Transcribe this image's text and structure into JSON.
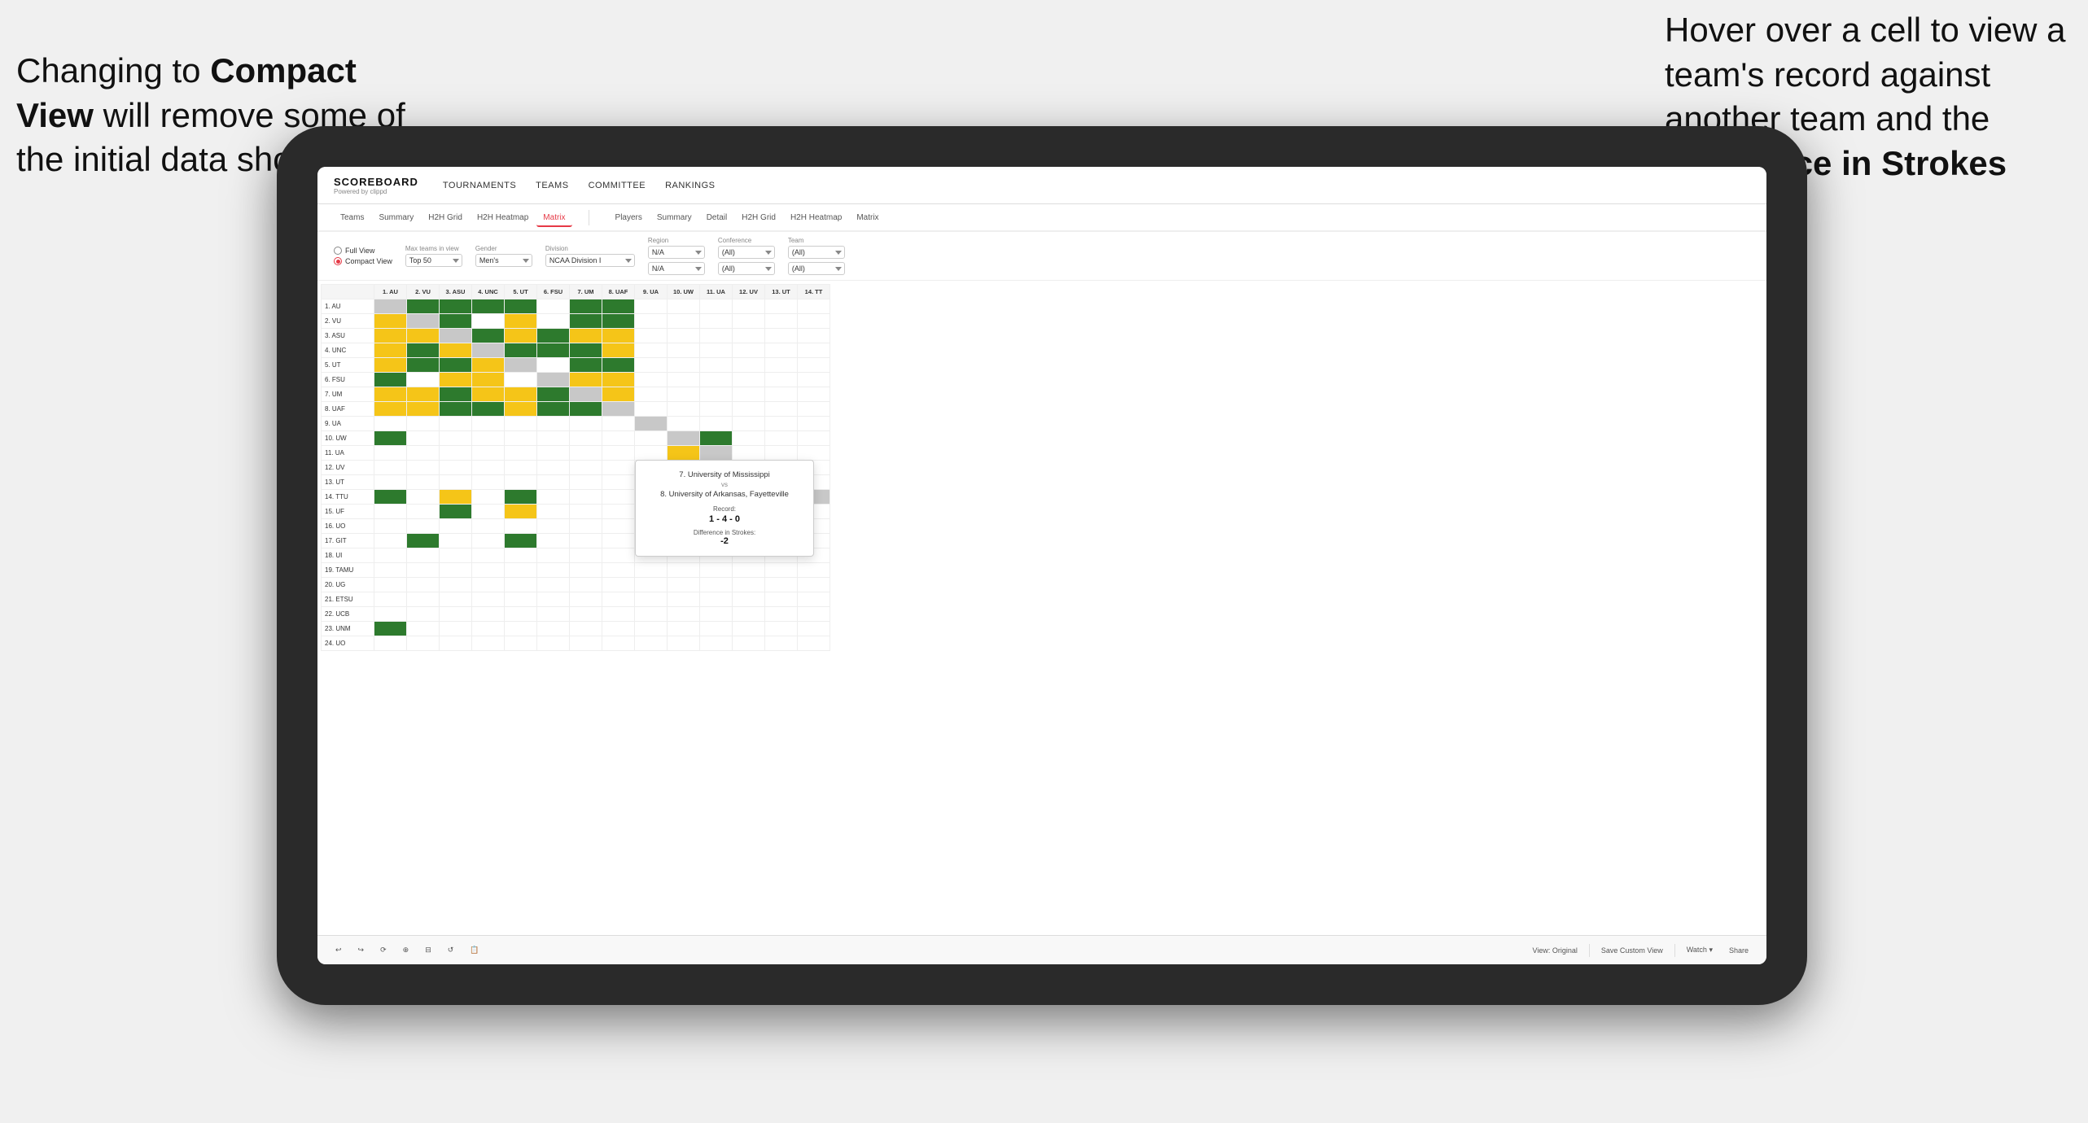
{
  "annotations": {
    "left_text": "Changing to Compact View will remove some of the initial data shown",
    "left_bold": "Compact View",
    "right_text": "Hover over a cell to view a team's record against another team and the Difference in Strokes",
    "right_bold": "Difference in Strokes"
  },
  "nav": {
    "logo": "SCOREBOARD",
    "logo_sub": "Powered by clippd",
    "links": [
      "TOURNAMENTS",
      "TEAMS",
      "COMMITTEE",
      "RANKINGS"
    ]
  },
  "sub_nav_left": {
    "tabs": [
      "Teams",
      "Summary",
      "H2H Grid",
      "H2H Heatmap",
      "Matrix"
    ]
  },
  "sub_nav_right": {
    "tabs": [
      "Players",
      "Summary",
      "Detail",
      "H2H Grid",
      "H2H Heatmap",
      "Matrix"
    ]
  },
  "filters": {
    "view_options": [
      "Full View",
      "Compact View"
    ],
    "selected_view": "Compact View",
    "max_teams_label": "Max teams in view",
    "max_teams_value": "Top 50",
    "gender_label": "Gender",
    "gender_value": "Men's",
    "division_label": "Division",
    "division_value": "NCAA Division I",
    "region_label": "Region",
    "region_values": [
      "N/A",
      "N/A"
    ],
    "conference_label": "Conference",
    "conference_values": [
      "(All)",
      "(All)"
    ],
    "team_label": "Team",
    "team_values": [
      "(All)",
      "(All)"
    ]
  },
  "matrix": {
    "col_headers": [
      "1. AU",
      "2. VU",
      "3. ASU",
      "4. UNC",
      "5. UT",
      "6. FSU",
      "7. UM",
      "8. UAF",
      "9. UA",
      "10. UW",
      "11. UA",
      "12. UV",
      "13. UT",
      "14. TT"
    ],
    "rows": [
      {
        "label": "1. AU",
        "cells": [
          "gray",
          "green",
          "green",
          "green",
          "green",
          "white",
          "green",
          "green",
          "white",
          "white",
          "white",
          "white",
          "white",
          "white"
        ]
      },
      {
        "label": "2. VU",
        "cells": [
          "yellow",
          "gray",
          "green",
          "white",
          "yellow",
          "white",
          "green",
          "green",
          "white",
          "white",
          "white",
          "white",
          "white",
          "white"
        ]
      },
      {
        "label": "3. ASU",
        "cells": [
          "yellow",
          "yellow",
          "gray",
          "green",
          "yellow",
          "green",
          "yellow",
          "yellow",
          "white",
          "white",
          "white",
          "white",
          "white",
          "white"
        ]
      },
      {
        "label": "4. UNC",
        "cells": [
          "yellow",
          "green",
          "yellow",
          "gray",
          "green",
          "green",
          "green",
          "yellow",
          "white",
          "white",
          "white",
          "white",
          "white",
          "white"
        ]
      },
      {
        "label": "5. UT",
        "cells": [
          "yellow",
          "green",
          "green",
          "yellow",
          "gray",
          "white",
          "green",
          "green",
          "white",
          "white",
          "white",
          "white",
          "white",
          "white"
        ]
      },
      {
        "label": "6. FSU",
        "cells": [
          "green",
          "white",
          "yellow",
          "yellow",
          "white",
          "gray",
          "yellow",
          "yellow",
          "white",
          "white",
          "white",
          "white",
          "white",
          "white"
        ]
      },
      {
        "label": "7. UM",
        "cells": [
          "yellow",
          "yellow",
          "green",
          "yellow",
          "yellow",
          "green",
          "gray",
          "yellow",
          "white",
          "white",
          "white",
          "white",
          "white",
          "white"
        ]
      },
      {
        "label": "8. UAF",
        "cells": [
          "yellow",
          "yellow",
          "green",
          "green",
          "yellow",
          "green",
          "green",
          "gray",
          "white",
          "white",
          "white",
          "white",
          "white",
          "white"
        ]
      },
      {
        "label": "9. UA",
        "cells": [
          "white",
          "white",
          "white",
          "white",
          "white",
          "white",
          "white",
          "white",
          "gray",
          "white",
          "white",
          "white",
          "white",
          "white"
        ]
      },
      {
        "label": "10. UW",
        "cells": [
          "green",
          "white",
          "white",
          "white",
          "white",
          "white",
          "white",
          "white",
          "white",
          "gray",
          "green",
          "white",
          "white",
          "white"
        ]
      },
      {
        "label": "11. UA",
        "cells": [
          "white",
          "white",
          "white",
          "white",
          "white",
          "white",
          "white",
          "white",
          "white",
          "yellow",
          "gray",
          "white",
          "white",
          "white"
        ]
      },
      {
        "label": "12. UV",
        "cells": [
          "white",
          "white",
          "white",
          "white",
          "white",
          "white",
          "white",
          "white",
          "white",
          "green",
          "white",
          "gray",
          "white",
          "white"
        ]
      },
      {
        "label": "13. UT",
        "cells": [
          "white",
          "white",
          "white",
          "white",
          "white",
          "white",
          "white",
          "white",
          "white",
          "white",
          "white",
          "white",
          "gray",
          "white"
        ]
      },
      {
        "label": "14. TTU",
        "cells": [
          "green",
          "white",
          "yellow",
          "white",
          "green",
          "white",
          "white",
          "white",
          "white",
          "yellow",
          "white",
          "white",
          "white",
          "gray"
        ]
      },
      {
        "label": "15. UF",
        "cells": [
          "white",
          "white",
          "green",
          "white",
          "yellow",
          "white",
          "white",
          "white",
          "white",
          "green",
          "white",
          "white",
          "white",
          "white"
        ]
      },
      {
        "label": "16. UO",
        "cells": [
          "white",
          "white",
          "white",
          "white",
          "white",
          "white",
          "white",
          "white",
          "white",
          "white",
          "white",
          "white",
          "white",
          "white"
        ]
      },
      {
        "label": "17. GIT",
        "cells": [
          "white",
          "green",
          "white",
          "white",
          "green",
          "white",
          "white",
          "white",
          "white",
          "white",
          "white",
          "white",
          "white",
          "white"
        ]
      },
      {
        "label": "18. UI",
        "cells": [
          "white",
          "white",
          "white",
          "white",
          "white",
          "white",
          "white",
          "white",
          "white",
          "white",
          "white",
          "white",
          "white",
          "white"
        ]
      },
      {
        "label": "19. TAMU",
        "cells": [
          "white",
          "white",
          "white",
          "white",
          "white",
          "white",
          "white",
          "white",
          "white",
          "white",
          "white",
          "white",
          "white",
          "white"
        ]
      },
      {
        "label": "20. UG",
        "cells": [
          "white",
          "white",
          "white",
          "white",
          "white",
          "white",
          "white",
          "white",
          "white",
          "white",
          "white",
          "white",
          "white",
          "white"
        ]
      },
      {
        "label": "21. ETSU",
        "cells": [
          "white",
          "white",
          "white",
          "white",
          "white",
          "white",
          "white",
          "white",
          "white",
          "white",
          "white",
          "white",
          "white",
          "white"
        ]
      },
      {
        "label": "22. UCB",
        "cells": [
          "white",
          "white",
          "white",
          "white",
          "white",
          "white",
          "white",
          "white",
          "white",
          "white",
          "white",
          "white",
          "white",
          "white"
        ]
      },
      {
        "label": "23. UNM",
        "cells": [
          "green",
          "white",
          "white",
          "white",
          "white",
          "white",
          "white",
          "white",
          "white",
          "white",
          "white",
          "white",
          "white",
          "white"
        ]
      },
      {
        "label": "24. UO",
        "cells": [
          "white",
          "white",
          "white",
          "white",
          "white",
          "white",
          "white",
          "white",
          "white",
          "white",
          "white",
          "white",
          "white",
          "white"
        ]
      }
    ]
  },
  "tooltip": {
    "team1": "7. University of Mississippi",
    "vs": "vs",
    "team2": "8. University of Arkansas, Fayetteville",
    "record_label": "Record:",
    "record_value": "1 - 4 - 0",
    "strokes_label": "Difference in Strokes:",
    "strokes_value": "-2"
  },
  "toolbar": {
    "buttons": [
      "↩",
      "↪",
      "⟳",
      "⊕",
      "⊟",
      "↺",
      "📋"
    ],
    "view_label": "View: Original",
    "save_label": "Save Custom View",
    "watch_label": "Watch ▾",
    "share_label": "Share"
  }
}
